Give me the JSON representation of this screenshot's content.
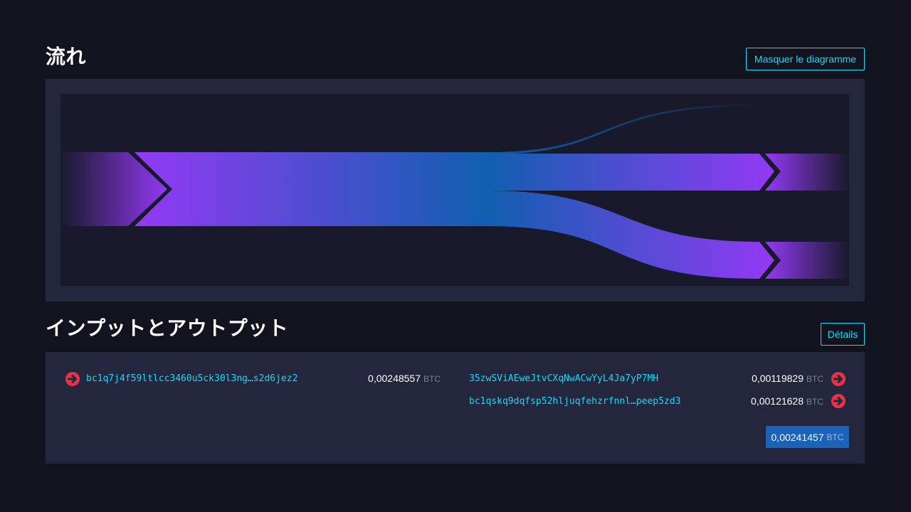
{
  "flow": {
    "title": "流れ",
    "toggle_label": "Masquer le diagramme"
  },
  "io": {
    "title": "インプットとアウトプット",
    "details_label": "Détails",
    "inputs": [
      {
        "address": "bc1q7j4f59ltlcc3460u5ck30l3ng…s2d6jez2",
        "amount": "0,00248557",
        "unit": "BTC"
      }
    ],
    "outputs": [
      {
        "address": "35zwSViAEweJtvCXqNwACwYyL4Ja7yP7MH",
        "amount": "0,00119829",
        "unit": "BTC"
      },
      {
        "address": "bc1qskq9dqfsp52hljuqfehzrfnnl…peep5zd3",
        "amount": "0,00121628",
        "unit": "BTC"
      }
    ],
    "total": {
      "amount": "0,00241457",
      "unit": "BTC"
    }
  },
  "icons": {
    "input_arrow": "arrow-right-circle-icon",
    "output_arrow": "arrow-right-circle-icon"
  },
  "colors": {
    "background": "#11131f",
    "panel": "#24263d",
    "accent": "#1bd8f4",
    "flow_purple": "#9339f4",
    "flow_blue": "#105fb0",
    "arrow_red": "#e5334b",
    "total_badge": "#1a63b9"
  }
}
